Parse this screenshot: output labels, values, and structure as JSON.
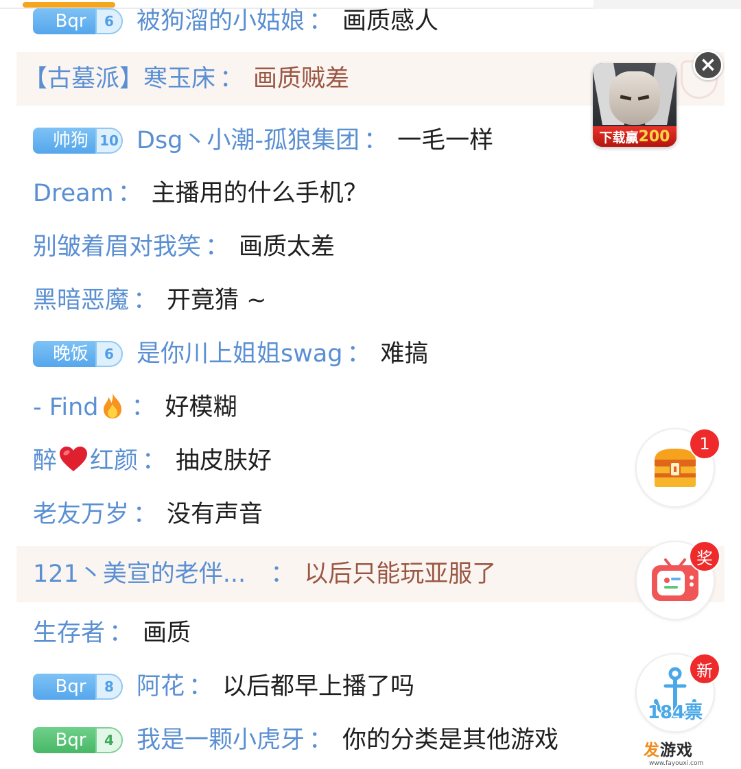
{
  "colon": "：",
  "messages": [
    {
      "badge": {
        "text": "Bqr",
        "level": "6",
        "color": "blue"
      },
      "user": "被狗溜的小姑娘",
      "text": "画质感人",
      "highlight": false
    },
    {
      "badge": null,
      "user": "【古墓派】寒玉床",
      "text": "画质贼差",
      "highlight": true
    },
    {
      "badge": {
        "text": "帅狗",
        "level": "10",
        "color": "blue"
      },
      "user": "Dsg丶小潮-孤狼集团",
      "text": "一毛一样",
      "highlight": false
    },
    {
      "badge": null,
      "user": "Dream",
      "text": "主播用的什么手机？",
      "highlight": false
    },
    {
      "badge": null,
      "user": "别皱着眉对我笑",
      "text": "画质太差",
      "highlight": false
    },
    {
      "badge": null,
      "user": "黑暗恶魔",
      "text": "开竟猜 ~",
      "highlight": false
    },
    {
      "badge": {
        "text": "晚饭",
        "level": "6",
        "color": "blue"
      },
      "user": "是你川上姐姐swag",
      "text": "难搞",
      "highlight": false
    },
    {
      "badge": null,
      "user": "- Find",
      "user_icon": "fire-emoji-icon",
      "text": "好模糊",
      "highlight": false
    },
    {
      "badge": null,
      "user_prefix": "醉",
      "user_icon": "heart-emoji-icon",
      "user_suffix": "红颜",
      "text": "抽皮肤好",
      "highlight": false
    },
    {
      "badge": null,
      "user": "老友万岁",
      "text": "没有声音",
      "highlight": false
    },
    {
      "badge": null,
      "user": "121丶美宣的老伴...",
      "text": "以后只能玩亚服了",
      "highlight": true
    },
    {
      "badge": null,
      "user": "生存者",
      "text": "画质",
      "highlight": false
    },
    {
      "badge": {
        "text": "Bqr",
        "level": "8",
        "color": "blue"
      },
      "user": "阿花",
      "text": "以后都早上播了吗",
      "highlight": false
    },
    {
      "badge": {
        "text": "Bqr",
        "level": "4",
        "color": "green"
      },
      "user": "我是一颗小虎牙",
      "text": "你的分类是其他游戏",
      "highlight": false
    }
  ],
  "ad": {
    "download_label": "下载赢",
    "download_amount": "200",
    "close_icon": "close-icon",
    "close_glyph": "×"
  },
  "floating_buttons": {
    "chest": {
      "badge": "1",
      "icon": "treasure-chest-icon"
    },
    "tv": {
      "badge": "奖",
      "icon": "tv-icon"
    },
    "anchor": {
      "badge": "新",
      "votes": "184票",
      "icon": "anchor-icon"
    }
  },
  "watermark": {
    "prefix": "发",
    "main": "游戏",
    "url": "www.fayouxi.com"
  },
  "colors": {
    "username": "#5a8fd2",
    "highlight_bg": "#fbf5f2",
    "highlight_text": "#9b5744",
    "badge_red": "#ee2a2a",
    "accent_orange": "#f6a51f"
  }
}
